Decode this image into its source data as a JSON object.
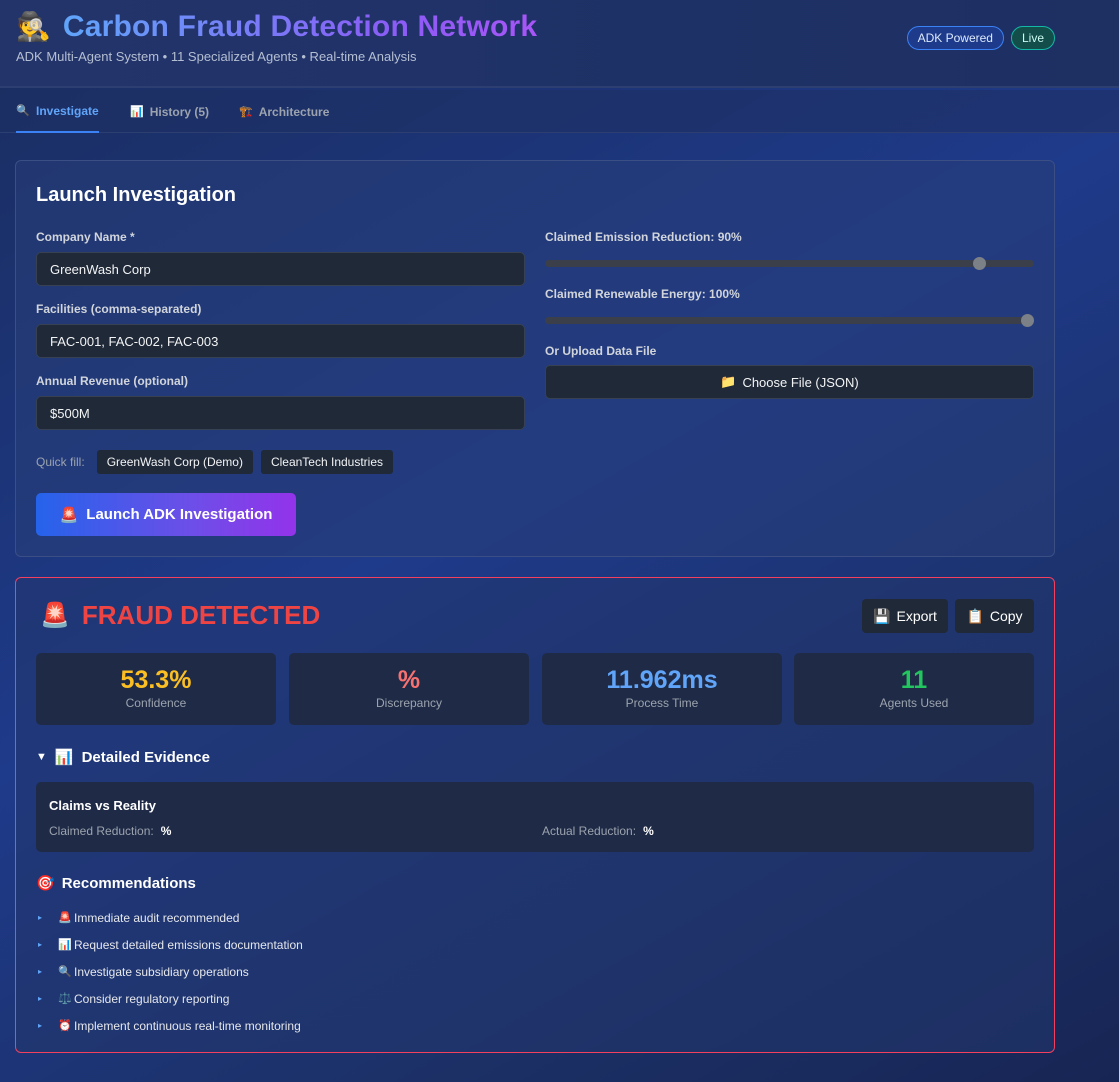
{
  "header": {
    "logo_icon": "detective-icon",
    "title": "Carbon Fraud Detection Network",
    "subtitle": "ADK Multi-Agent System • 11 Specialized Agents • Real-time Analysis",
    "badges": [
      "ADK Powered",
      "Live"
    ]
  },
  "tabs": [
    {
      "label": "Investigate",
      "icon": "magnifier-icon",
      "active": true
    },
    {
      "label": "History (5)",
      "icon": "bar-chart-icon",
      "active": false
    },
    {
      "label": "Architecture",
      "icon": "building-icon",
      "active": false
    }
  ],
  "launch": {
    "heading": "Launch Investigation",
    "company_label": "Company Name *",
    "company_value": "GreenWash Corp",
    "facilities_label": "Facilities (comma-separated)",
    "facilities_value": "FAC-001, FAC-002, FAC-003",
    "revenue_label": "Annual Revenue (optional)",
    "revenue_value": "$500M",
    "emission_label": "Claimed Emission Reduction: 90%",
    "emission_value": 0.9,
    "renewable_label": "Claimed Renewable Energy: 100%",
    "renewable_value": 1.0,
    "upload_label": "Or Upload Data File",
    "upload_button": "Choose File (JSON)",
    "quick_fill_label": "Quick fill:",
    "quick_fill": [
      "GreenWash Corp (Demo)",
      "CleanTech Industries"
    ],
    "launch_button": "Launch ADK Investigation"
  },
  "result": {
    "status": "FRAUD DETECTED",
    "export_label": "Export",
    "copy_label": "Copy",
    "metrics": [
      {
        "value": "53.3%",
        "label": "Confidence",
        "color": "#fbbf24"
      },
      {
        "value": "%",
        "label": "Discrepancy",
        "color": "#f87171"
      },
      {
        "value": "11.962ms",
        "label": "Process Time",
        "color": "#60a5fa"
      },
      {
        "value": "11",
        "label": "Agents Used",
        "color": "#22c55e"
      }
    ],
    "evidence_heading": "Detailed Evidence",
    "claims_title": "Claims vs Reality",
    "claimed_label": "Claimed Reduction:",
    "claimed_value": "%",
    "actual_label": "Actual Reduction:",
    "actual_value": "%",
    "recommendations_heading": "Recommendations",
    "recommendations": [
      {
        "icon": "siren-icon",
        "text": "Immediate audit recommended"
      },
      {
        "icon": "bar-chart-icon",
        "text": "Request detailed emissions documentation"
      },
      {
        "icon": "magnifier-icon",
        "text": "Investigate subsidiary operations"
      },
      {
        "icon": "scales-icon",
        "text": "Consider regulatory reporting"
      },
      {
        "icon": "alarm-clock-icon",
        "text": "Implement continuous real-time monitoring"
      }
    ]
  }
}
